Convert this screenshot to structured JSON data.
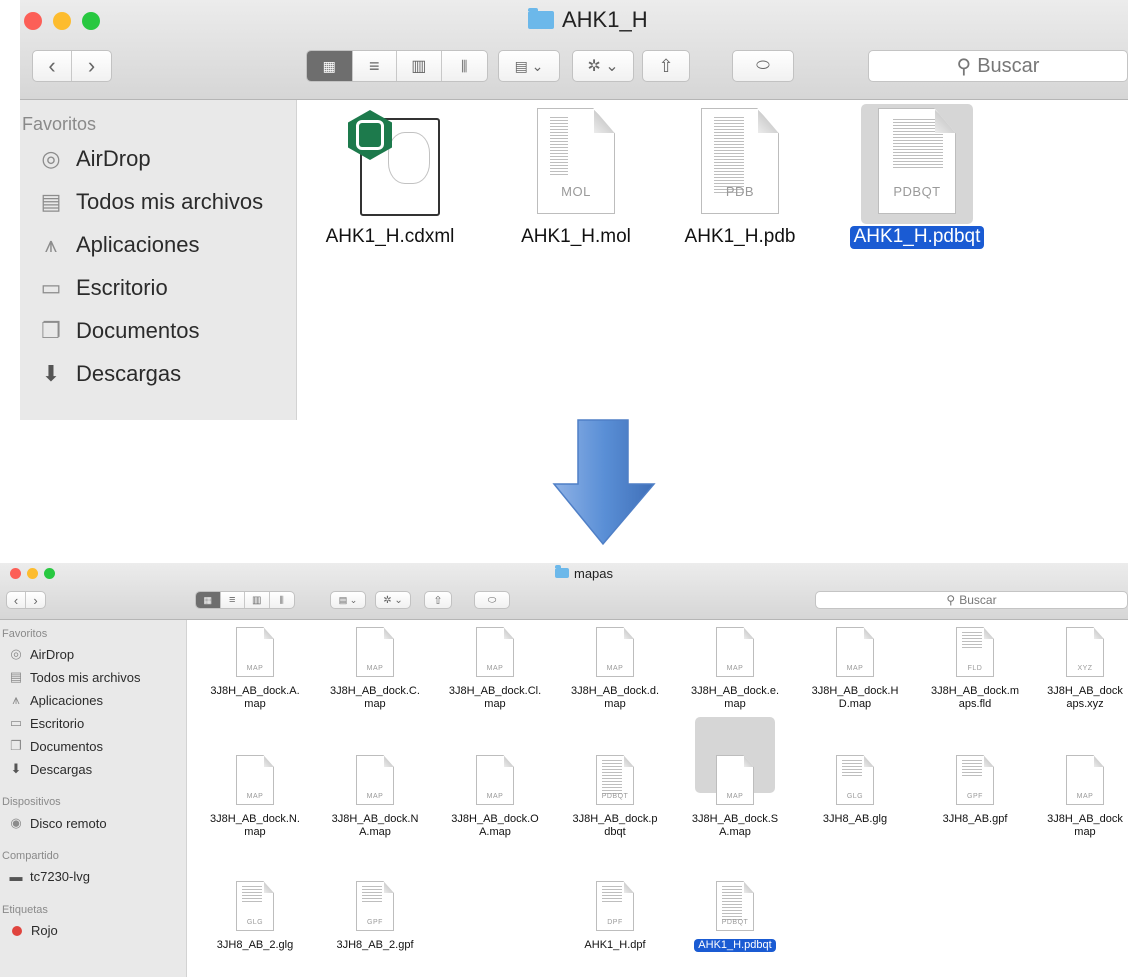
{
  "top_window": {
    "title": "AHK1_H",
    "search_placeholder": "Buscar",
    "sidebar": {
      "favorites_header": "Favoritos",
      "items": [
        {
          "label": "AirDrop",
          "icon": "airdrop-icon"
        },
        {
          "label": "Todos mis archivos",
          "icon": "all-files-icon"
        },
        {
          "label": "Aplicaciones",
          "icon": "applications-icon"
        },
        {
          "label": "Escritorio",
          "icon": "desktop-icon"
        },
        {
          "label": "Documentos",
          "icon": "documents-icon"
        },
        {
          "label": "Descargas",
          "icon": "downloads-icon"
        }
      ]
    },
    "files": [
      {
        "name": "AHK1_H.cdxml",
        "type": "",
        "icon": "chemdraw-icon"
      },
      {
        "name": "AHK1_H.mol",
        "type": "MOL"
      },
      {
        "name": "AHK1_H.pdb",
        "type": "PDB"
      },
      {
        "name": "AHK1_H.pdbqt",
        "type": "PDBQT",
        "selected": true
      }
    ]
  },
  "arrow": {
    "color": "#4f7fc6",
    "icon": "down-arrow-icon"
  },
  "bottom_window": {
    "title": "mapas",
    "search_placeholder": "Buscar",
    "sidebar": {
      "favorites_header": "Favoritos",
      "items": [
        {
          "label": "AirDrop",
          "icon": "airdrop-icon"
        },
        {
          "label": "Todos mis archivos",
          "icon": "all-files-icon"
        },
        {
          "label": "Aplicaciones",
          "icon": "applications-icon"
        },
        {
          "label": "Escritorio",
          "icon": "desktop-icon"
        },
        {
          "label": "Documentos",
          "icon": "documents-icon"
        },
        {
          "label": "Descargas",
          "icon": "downloads-icon"
        }
      ],
      "devices_header": "Dispositivos",
      "devices": [
        {
          "label": "Disco remoto",
          "icon": "remote-disc-icon"
        }
      ],
      "shared_header": "Compartido",
      "shared": [
        {
          "label": "tc7230-lvg",
          "icon": "computer-icon"
        }
      ],
      "tags_header": "Etiquetas",
      "tags": [
        {
          "label": "Rojo",
          "color": "#e0443e"
        }
      ]
    },
    "files": [
      {
        "line1": "3J8H_AB_dock.A.",
        "line2": "map",
        "type": "MAP"
      },
      {
        "line1": "3J8H_AB_dock.C.",
        "line2": "map",
        "type": "MAP"
      },
      {
        "line1": "3J8H_AB_dock.Cl.",
        "line2": "map",
        "type": "MAP"
      },
      {
        "line1": "3J8H_AB_dock.d.",
        "line2": "map",
        "type": "MAP"
      },
      {
        "line1": "3J8H_AB_dock.e.",
        "line2": "map",
        "type": "MAP"
      },
      {
        "line1": "3J8H_AB_dock.H",
        "line2": "D.map",
        "type": "MAP"
      },
      {
        "line1": "3J8H_AB_dock.m",
        "line2": "aps.fld",
        "type": "FLD"
      },
      {
        "line1": "3J8H_AB_dock",
        "line2": "aps.xyz",
        "type": "XYZ"
      },
      {
        "line1": "3J8H_AB_dock.N.",
        "line2": "map",
        "type": "MAP"
      },
      {
        "line1": "3J8H_AB_dock.N",
        "line2": "A.map",
        "type": "MAP"
      },
      {
        "line1": "3J8H_AB_dock.O",
        "line2": "A.map",
        "type": "MAP"
      },
      {
        "line1": "3J8H_AB_dock.p",
        "line2": "dbqt",
        "type": "PDBQT"
      },
      {
        "line1": "3J8H_AB_dock.S",
        "line2": "A.map",
        "type": "MAP"
      },
      {
        "line1": "3JH8_AB.glg",
        "line2": "",
        "type": "GLG"
      },
      {
        "line1": "3JH8_AB.gpf",
        "line2": "",
        "type": "GPF"
      },
      {
        "line1": "3J8H_AB_dock",
        "line2": "map",
        "type": "MAP"
      },
      {
        "line1": "3JH8_AB_2.glg",
        "line2": "",
        "type": "GLG"
      },
      {
        "line1": "3JH8_AB_2.gpf",
        "line2": "",
        "type": "GPF"
      },
      {
        "line1": "AHK1_H.dpf",
        "line2": "",
        "type": "DPF"
      },
      {
        "line1": "AHK1_H.pdbqt",
        "line2": "",
        "type": "PDBQT",
        "selected": true
      }
    ]
  }
}
